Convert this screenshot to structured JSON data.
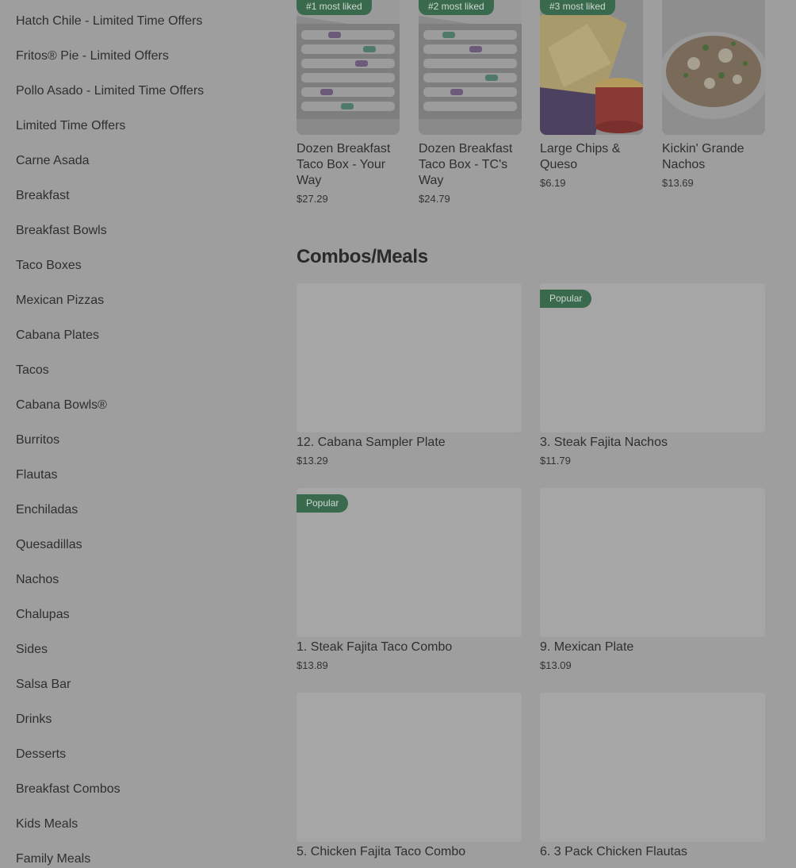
{
  "sidebar": {
    "items": [
      {
        "label": "Hatch Chile - Limited Time Offers"
      },
      {
        "label": "Fritos® Pie - Limited Offers"
      },
      {
        "label": "Pollo Asado - Limited Time Offers"
      },
      {
        "label": "Limited Time Offers"
      },
      {
        "label": "Carne Asada"
      },
      {
        "label": "Breakfast"
      },
      {
        "label": "Breakfast Bowls"
      },
      {
        "label": "Taco Boxes"
      },
      {
        "label": "Mexican Pizzas"
      },
      {
        "label": "Cabana Plates"
      },
      {
        "label": "Tacos"
      },
      {
        "label": "Cabana Bowls®"
      },
      {
        "label": "Burritos"
      },
      {
        "label": "Flautas"
      },
      {
        "label": "Enchiladas"
      },
      {
        "label": "Quesadillas"
      },
      {
        "label": "Nachos"
      },
      {
        "label": "Chalupas"
      },
      {
        "label": "Sides"
      },
      {
        "label": "Salsa Bar"
      },
      {
        "label": "Drinks"
      },
      {
        "label": "Desserts"
      },
      {
        "label": "Breakfast Combos"
      },
      {
        "label": "Kids Meals"
      },
      {
        "label": "Family Meals"
      }
    ]
  },
  "most_liked": {
    "items": [
      {
        "badge": "#1 most liked",
        "name": "Dozen Breakfast Taco Box - Your Way",
        "price": "$27.29"
      },
      {
        "badge": "#2 most liked",
        "name": "Dozen Breakfast Taco Box - TC's Way",
        "price": "$24.79"
      },
      {
        "badge": "#3 most liked",
        "name": "Large Chips & Queso",
        "price": "$6.19"
      },
      {
        "badge": "",
        "name": "Kickin' Grande Nachos",
        "price": "$13.69"
      }
    ]
  },
  "combos": {
    "title": "Combos/Meals",
    "items": [
      {
        "name": "12. Cabana Sampler Plate",
        "price": "$13.29",
        "badge": ""
      },
      {
        "name": "3. Steak Fajita Nachos",
        "price": "$11.79",
        "badge": "Popular"
      },
      {
        "name": "1. Steak Fajita Taco Combo",
        "price": "$13.89",
        "badge": "Popular"
      },
      {
        "name": "9. Mexican Plate",
        "price": "$13.09",
        "badge": ""
      },
      {
        "name": "5. Chicken Fajita Taco Combo",
        "price": "",
        "badge": ""
      },
      {
        "name": "6. 3 Pack Chicken Flautas",
        "price": "",
        "badge": ""
      }
    ]
  },
  "colors": {
    "overlay_bg": "#9e9e9e",
    "badge_green": "#3a6a4e",
    "placeholder": "#a6a6a6"
  }
}
